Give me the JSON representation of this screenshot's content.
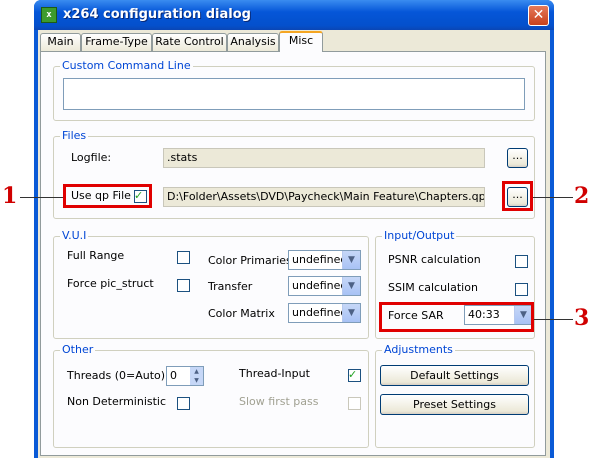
{
  "window": {
    "title": "x264 configuration dialog",
    "icon": "x264-app-icon",
    "close_glyph": "✕"
  },
  "tabs": [
    {
      "label": "Main",
      "active": false
    },
    {
      "label": "Frame-Type",
      "active": false
    },
    {
      "label": "Rate Control",
      "active": false
    },
    {
      "label": "Analysis",
      "active": false
    },
    {
      "label": "Misc",
      "active": true
    }
  ],
  "custom_command_line": {
    "legend": "Custom Command Line",
    "value": ""
  },
  "files": {
    "legend": "Files",
    "logfile_label": "Logfile:",
    "logfile_value": ".stats",
    "logfile_browse": "...",
    "use_qp_label": "Use qp File",
    "use_qp_checked": true,
    "qp_file_value": "D:\\Folder\\Assets\\DVD\\Paycheck\\Main Feature\\Chapters.qpf",
    "qp_browse": "..."
  },
  "vui": {
    "legend": "V.U.I",
    "full_range_label": "Full Range",
    "force_pic_struct_label": "Force pic_struct",
    "color_primaries_label": "Color Primaries",
    "color_primaries_value": "undefined",
    "transfer_label": "Transfer",
    "transfer_value": "undefined",
    "color_matrix_label": "Color Matrix",
    "color_matrix_value": "undefined"
  },
  "io": {
    "legend": "Input/Output",
    "psnr_label": "PSNR calculation",
    "ssim_label": "SSIM calculation",
    "force_sar_label": "Force SAR",
    "force_sar_value": "40:33"
  },
  "other": {
    "legend": "Other",
    "threads_label": "Threads (0=Auto)",
    "threads_value": "0",
    "thread_input_label": "Thread-Input",
    "thread_input_checked": true,
    "non_deterministic_label": "Non Deterministic",
    "slow_first_pass_label": "Slow first pass"
  },
  "adjustments": {
    "legend": "Adjustments",
    "default_button": "Default Settings",
    "preset_button": "Preset Settings"
  },
  "callouts": [
    "1",
    "2",
    "3"
  ],
  "colors": {
    "highlight": "#e00000",
    "legend_text": "#0046d5",
    "check": "#21a121"
  }
}
